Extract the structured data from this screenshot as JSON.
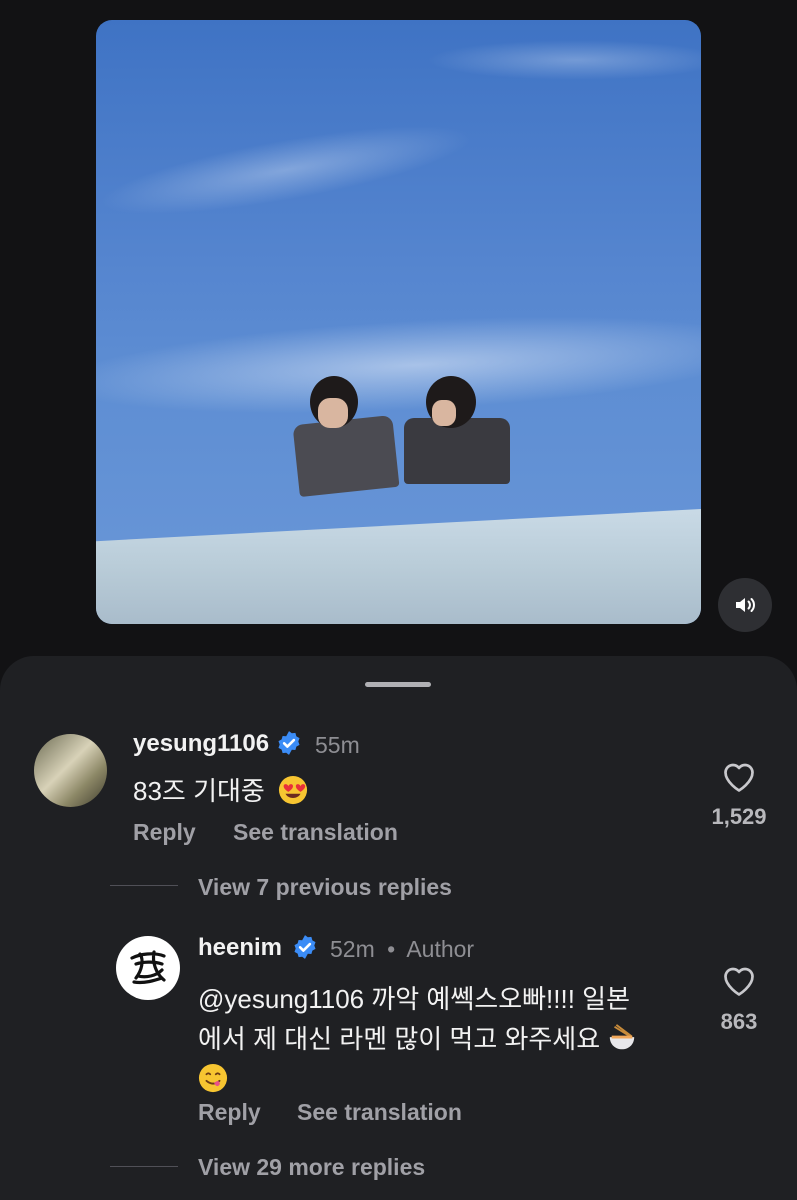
{
  "post": {
    "media_icon": "speaker-icon"
  },
  "comments": [
    {
      "username": "yesung1106",
      "time": "55m",
      "text": "83즈 기대중",
      "emoji": "heart-eyes-emoji",
      "reply_label": "Reply",
      "translate_label": "See translation",
      "likes": "1,529"
    },
    {
      "username": "heenim",
      "time": "52m",
      "author_badge": "Author",
      "text_line1": "@yesung1106 까악 예쎅스오빠!!!! 일본",
      "text_line2": "에서 제 대신 라멘 많이 먹고 와주세요",
      "emoji1": "ramen-emoji",
      "emoji2": "yum-emoji",
      "reply_label": "Reply",
      "translate_label": "See translation",
      "likes": "863"
    }
  ],
  "view_previous": "View 7 previous replies",
  "view_more": "View 29 more replies",
  "colors": {
    "background": "#121214",
    "sheet": "#1f2023",
    "verified": "#3b8cf6",
    "muted_text": "#8e8e93"
  }
}
